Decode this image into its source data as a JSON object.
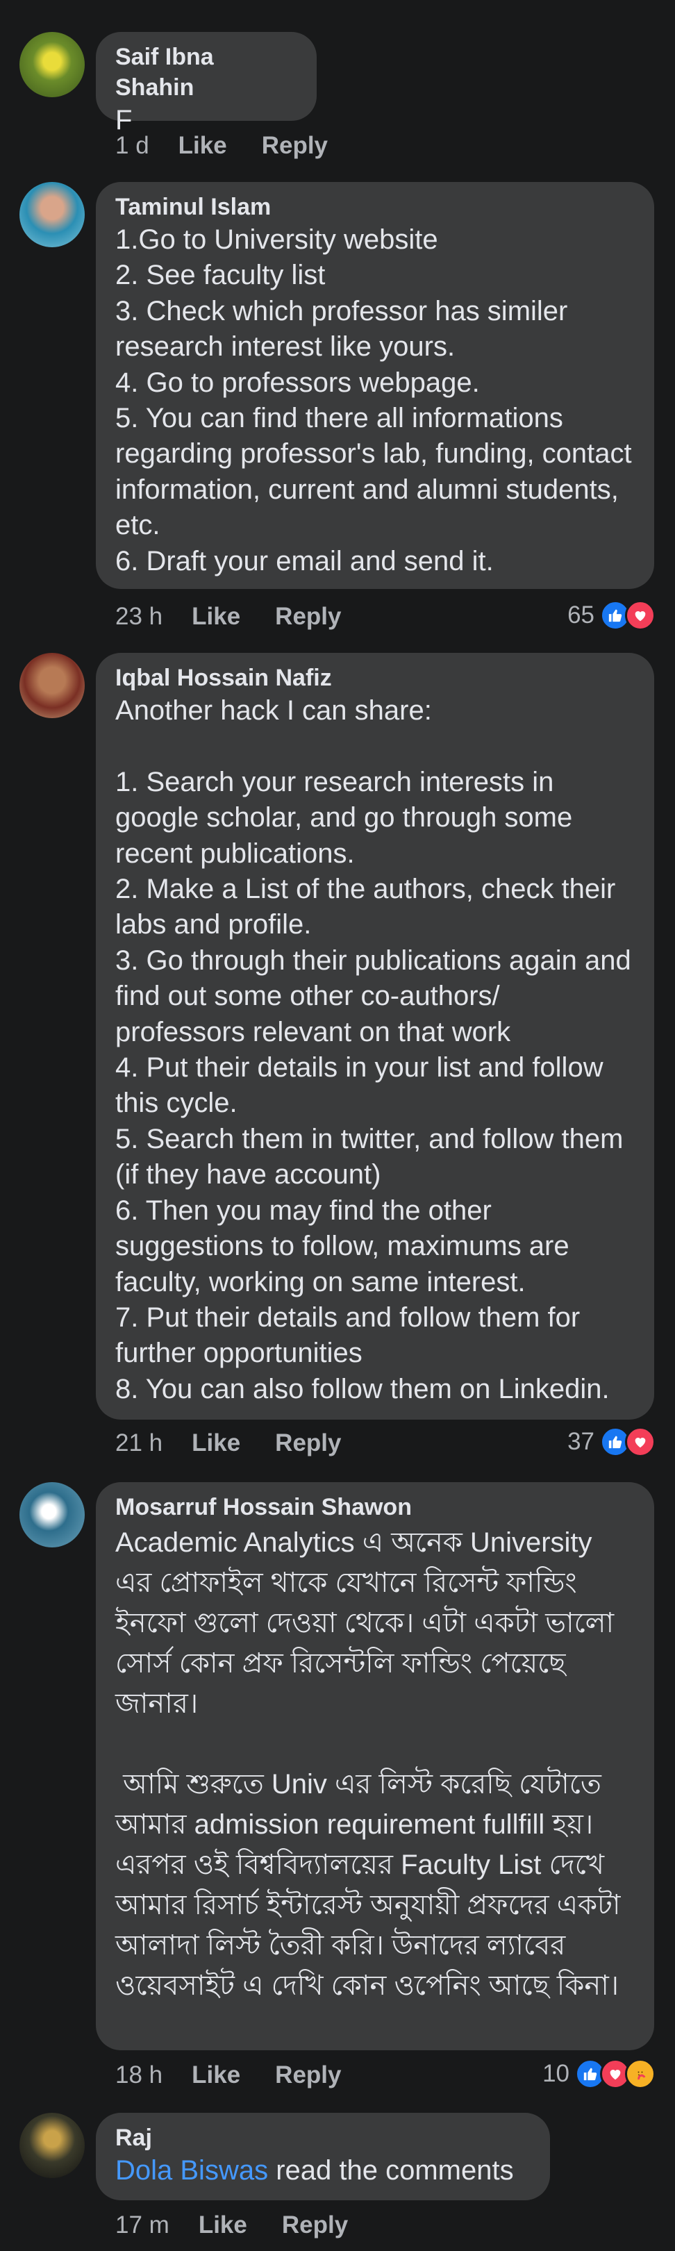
{
  "comments": [
    {
      "author": "Saif Ibna Shahin",
      "text": "F",
      "time": "1 d",
      "like": "Like",
      "reply": "Reply"
    },
    {
      "author": "Taminul Islam",
      "text": "1.Go to University website\n2. See faculty list\n3. Check which professor has similer research interest like yours.\n4. Go to professors webpage.\n5. You can find there all informations regarding professor's lab, funding, contact information, current and alumni students, etc.\n6. Draft your email and send it.",
      "time": "23 h",
      "like": "Like",
      "reply": "Reply",
      "reactions": "65"
    },
    {
      "author": "Iqbal Hossain Nafiz",
      "text": "Another hack I can share:\n\n1. Search your research interests in google scholar, and go through some recent publications.\n2. Make a List of the authors, check their labs and profile.\n3. Go through their publications again and find out some other co-authors/ professors relevant on that work\n4. Put their details in your list and follow this cycle.\n5. Search them in twitter, and follow them (if they have account)\n6. Then you may find the other suggestions to follow, maximums are faculty, working on same interest.\n7. Put their details and follow them for further opportunities\n8. You can also follow them on Linkedin.",
      "time": "21 h",
      "like": "Like",
      "reply": "Reply",
      "reactions": "37"
    },
    {
      "author": "Mosarruf Hossain Shawon",
      "text": "Academic Analytics এ অনেক University এর প্রোফাইল থাকে যেখানে রিসেন্ট ফান্ডিং ইনফো গুলো দেওয়া থেকে। এটা একটা ভালো সোর্স কোন প্রফ রিসেন্টলি ফান্ডিং পেয়েছে জানার।\n\n আমি শুরুতে Univ এর লিস্ট করেছি যেটাতে আমার admission requirement fullfill হয়। এরপর ওই বিশ্ববিদ্যালয়ের Faculty List দেখে আমার রিসার্চ ইন্টারেস্ট অনুযায়ী প্রফদের একটা আলাদা লিস্ট তৈরী করি। উনাদের ল্যাবের ওয়েবসাইট এ দেখি কোন ওপেনিং আছে কিনা।",
      "time": "18 h",
      "like": "Like",
      "reply": "Reply",
      "reactions": "10"
    },
    {
      "author": "Raj",
      "mention": "Dola Biswas",
      "text": " read the comments",
      "time": "17 m",
      "like": "Like",
      "reply": "Reply"
    }
  ],
  "colors": {
    "background": "#18191a",
    "bubble": "#3a3b3c",
    "text": "#e4e6eb",
    "meta": "#b0b3b8",
    "link": "#4599ff",
    "like_reaction": "#1877f2",
    "love_reaction": "#f33e58",
    "care_reaction": "#f7b125"
  },
  "icons": [
    "thumbs-up-reaction-icon",
    "heart-reaction-icon",
    "care-reaction-icon"
  ]
}
